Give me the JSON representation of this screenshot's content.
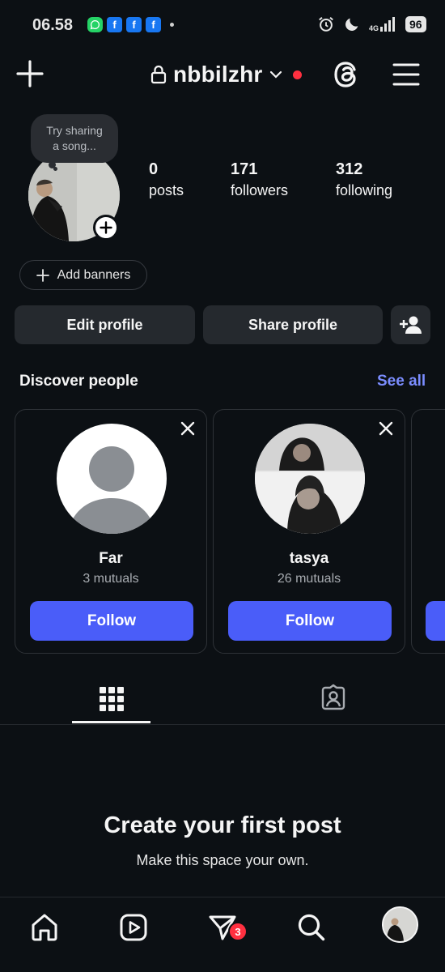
{
  "status_bar": {
    "time": "06.58",
    "network": "4G",
    "battery": "96",
    "notification_icons": [
      "whatsapp-icon",
      "facebook-icon",
      "facebook-icon",
      "facebook-icon"
    ]
  },
  "header": {
    "username": "nbbilzhr",
    "has_unread_indicator": true
  },
  "profile": {
    "note_prompt": "Try sharing a song...",
    "stats": [
      {
        "value": "0",
        "label": "posts"
      },
      {
        "value": "171",
        "label": "followers"
      },
      {
        "value": "312",
        "label": "following"
      }
    ],
    "add_banners_label": "Add banners",
    "edit_profile_label": "Edit profile",
    "share_profile_label": "Share profile"
  },
  "discover": {
    "title": "Discover people",
    "see_all_label": "See all",
    "suggestions": [
      {
        "name": "Far",
        "mutuals": "3 mutuals",
        "follow_label": "Follow"
      },
      {
        "name": "tasya",
        "mutuals": "26 mutuals",
        "follow_label": "Follow"
      }
    ]
  },
  "tabs": {
    "active": "grid"
  },
  "empty_state": {
    "title": "Create your first post",
    "subtitle": "Make this space your own."
  },
  "bottom_nav": {
    "items": [
      "home-icon",
      "reels-icon",
      "direct-icon",
      "search-icon",
      "profile-avatar"
    ],
    "messages_badge": "3"
  },
  "colors": {
    "background": "#0c1014",
    "button_bg": "#25292e",
    "accent_blue": "#4a5df9",
    "link_blue": "#7b8dff",
    "notification_red": "#ff3040"
  }
}
